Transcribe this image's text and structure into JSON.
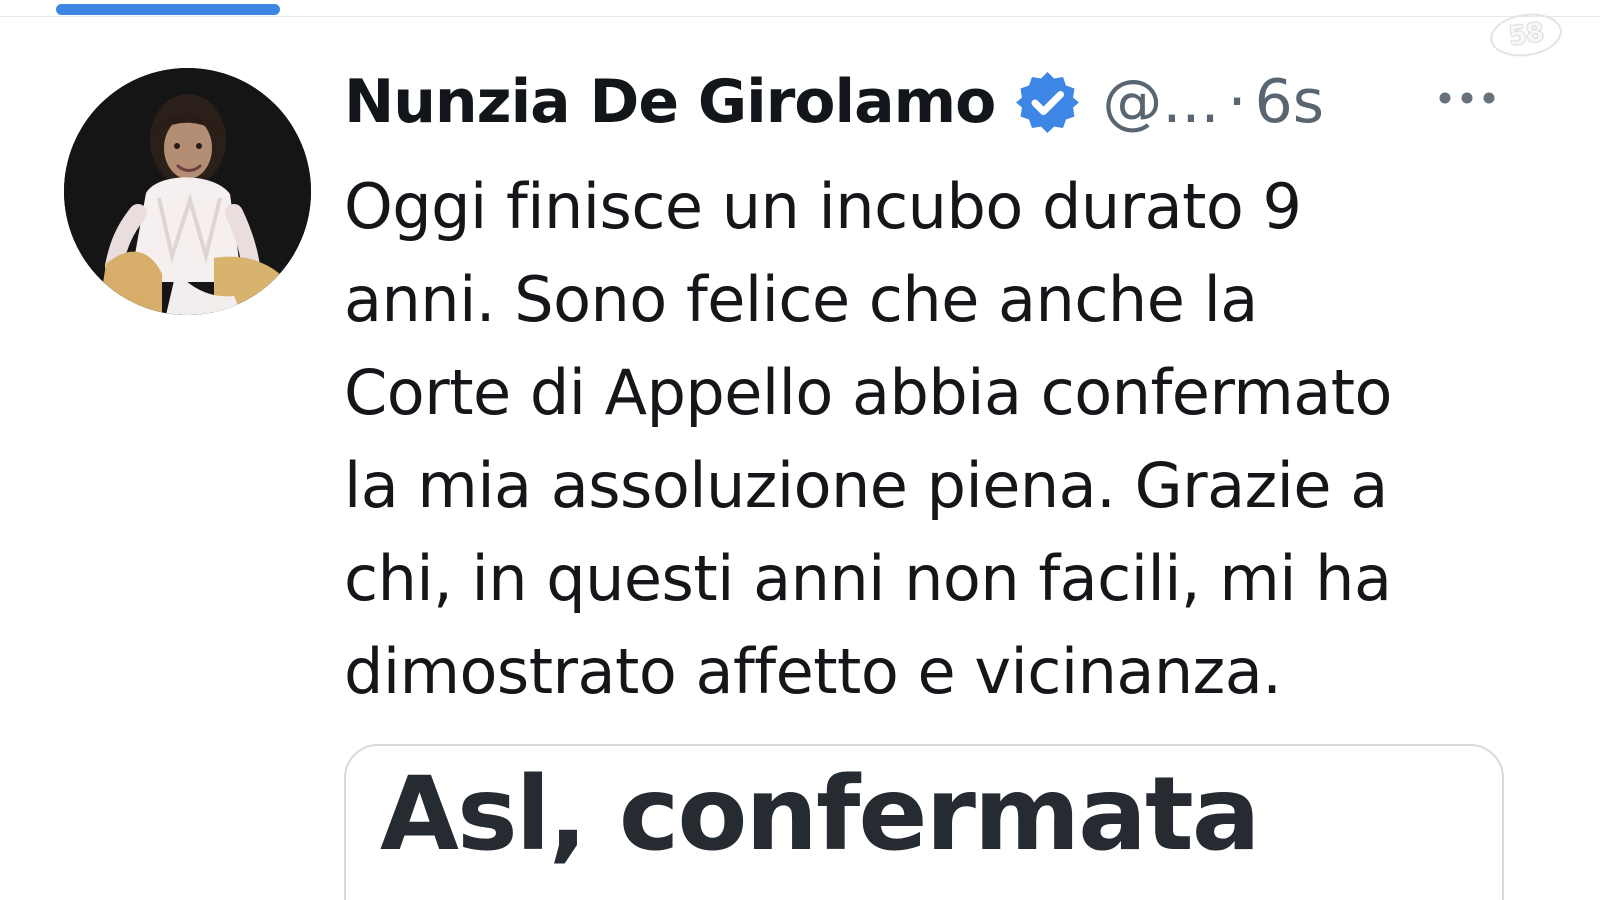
{
  "ui": {
    "accent_color": "#3d86e6",
    "text_color": "#141619",
    "muted_color": "#596672"
  },
  "overlay": {
    "channel_logo": "58"
  },
  "tweet": {
    "author_name": "Nunzia De Girolamo",
    "handle": "@...",
    "separator": "·",
    "time": "6s",
    "verified_icon": "verified-badge-icon",
    "more_icon": "more-options-icon",
    "text_lines": [
      "Oggi finisce un incubo durato 9",
      "anni. Sono felice che anche la",
      "Corte di Appello abbia confermato",
      "la mia assoluzione piena. Grazie a",
      "chi, in questi anni non facili, mi ha",
      "dimostrato affetto e vicinanza."
    ],
    "card_headline": "Asl, confermata"
  }
}
